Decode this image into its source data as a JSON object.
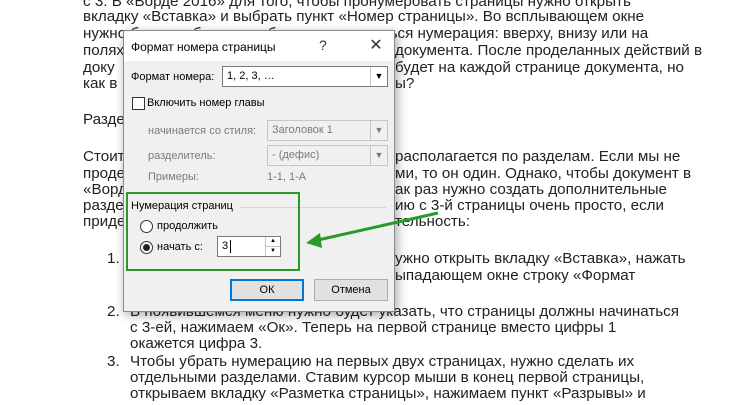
{
  "document": {
    "lines": [
      "с 3. В «Ворде 2016» для того, чтобы пронумеровать страницы нужно открыть",
      "вкладку «Вставка» и выбрать пункт «Номер страницы». Во всплывающем окне",
      "нужно будет выбрать, где будет располагаться нумерация: вверху, внизу или на",
      "полях",
      "документа. После проделанных действий в",
      "доку",
      "будет на каждой странице документа, но",
      "как в",
      "ы?",
      "Разде",
      "Стоит",
      "располагается по разделам. Если мы не",
      "проде",
      "ми, то он один. Однако, чтобы документ в",
      "«Ворд",
      "ак раз нужно создать дополнительные",
      "разде",
      "ию с 3-й страницы очень просто, если",
      "приде",
      "тельность:",
      "ужно открыть вкладку «Вставка», нажать",
      "ыпадающем окне строку «Формат",
      "В появившемся меню нужно будет указать, что страницы должны начинаться",
      "с 3-ей, нажимаем «Ок». Теперь на первой странице вместо цифры 1",
      "окажется цифра 3.",
      "Чтобы убрать нумерацию на первых двух страницах, нужно сделать их",
      "отдельными разделами. Ставим курсор мыши в конец первой страницы,",
      "открываем вкладку «Разметка страницы», нажимаем пункт «Разрывы» и"
    ],
    "numbers": [
      "1.",
      "2.",
      "3."
    ]
  },
  "dialog": {
    "title": "Формат номера страницы",
    "help": "?",
    "close": "✕",
    "format_label": "Формат номера:",
    "format_value": "1, 2, 3, …",
    "include_chapter_label": "Включить номер главы",
    "chapter_style_label": "начинается со стиля:",
    "chapter_style_value": "Заголовок 1",
    "separator_label": "разделитель:",
    "separator_value": "-    (дефис)",
    "examples_label": "Примеры:",
    "examples_value": "1-1, 1-А",
    "numbering_group": "Нумерация страниц",
    "continue_label": "продолжить",
    "start_at_label": "начать с:",
    "start_at_value": "3",
    "ok": "ОК",
    "cancel": "Отмена"
  },
  "colors": {
    "highlight": "#2a9a2a",
    "accent": "#0078d7"
  }
}
